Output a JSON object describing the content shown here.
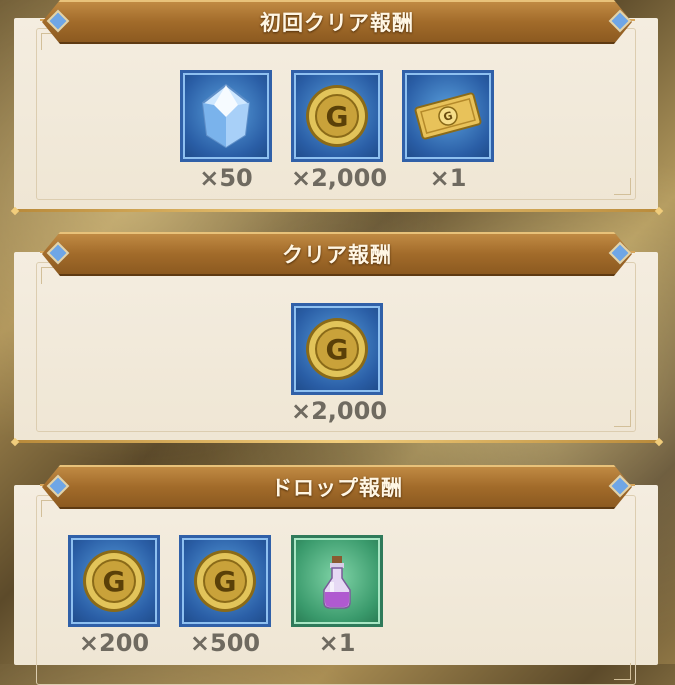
{
  "sections": [
    {
      "title": "初回クリア報酬",
      "rewards": [
        {
          "icon": "crystal-icon",
          "quantity": "×50"
        },
        {
          "icon": "gold-coin-icon",
          "quantity": "×2,000"
        },
        {
          "icon": "gold-ticket-icon",
          "quantity": "×1"
        }
      ]
    },
    {
      "title": "クリア報酬",
      "rewards": [
        {
          "icon": "gold-coin-icon",
          "quantity": "×2,000"
        }
      ]
    },
    {
      "title": "ドロップ報酬",
      "rewards": [
        {
          "icon": "gold-coin-icon",
          "quantity": "×200"
        },
        {
          "icon": "gold-coin-icon",
          "quantity": "×500"
        },
        {
          "icon": "potion-icon",
          "quantity": "×1"
        }
      ]
    }
  ],
  "colors": {
    "banner": "#a26b2a",
    "panel": "#f4ede0",
    "tile_blue": "#2a5ea6",
    "tile_green": "#3a9a6c",
    "quantity_text": "#6f6a60"
  }
}
